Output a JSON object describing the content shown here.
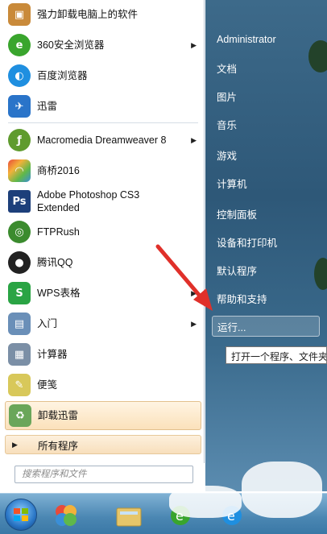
{
  "pinned_programs": [
    {
      "label": "强力卸载电脑上的软件",
      "icon": "uninstall-box-icon",
      "color": "#c98a3a",
      "has_submenu": false
    },
    {
      "label": "360安全浏览器",
      "icon": "360-browser-icon",
      "color": "#39a52d",
      "has_submenu": true
    },
    {
      "label": "百度浏览器",
      "icon": "baidu-browser-icon",
      "color": "#1f8fe0",
      "has_submenu": false
    },
    {
      "label": "迅雷",
      "icon": "xunlei-bird-icon",
      "color": "#2a74c9",
      "has_submenu": false
    }
  ],
  "recent_programs": [
    {
      "label": "Macromedia Dreamweaver 8",
      "icon": "dreamweaver-icon",
      "color": "#5f9b2e",
      "has_submenu": true
    },
    {
      "label": "商桥2016",
      "icon": "shangqiao-rainbow-icon",
      "color": "#e8a23a",
      "has_submenu": false
    },
    {
      "label": "Adobe Photoshop CS3",
      "label2": "Extended",
      "icon": "photoshop-icon",
      "color": "#1d3f7a",
      "has_submenu": false
    },
    {
      "label": "FTPRush",
      "icon": "ftprush-icon",
      "color": "#3b8b2e",
      "has_submenu": false
    },
    {
      "label": "腾讯QQ",
      "icon": "qq-penguin-icon",
      "color": "#222222",
      "has_submenu": false
    },
    {
      "label": "WPS表格",
      "icon": "wps-sheet-icon",
      "color": "#2aa444",
      "has_submenu": true
    },
    {
      "label": "入门",
      "icon": "getting-started-icon",
      "color": "#6a8fb8",
      "has_submenu": true
    },
    {
      "label": "计算器",
      "icon": "calculator-icon",
      "color": "#7b8fa6",
      "has_submenu": false
    },
    {
      "label": "便笺",
      "icon": "sticky-note-icon",
      "color": "#d8c85a",
      "has_submenu": false
    },
    {
      "label": "卸载迅雷",
      "icon": "recycle-uninstall-icon",
      "color": "#6aa65a",
      "has_submenu": false
    }
  ],
  "all_programs_label": "所有程序",
  "search_placeholder": "搜索程序和文件",
  "right_panel": {
    "items": [
      "Administrator",
      "文档",
      "图片",
      "音乐",
      "游戏",
      "计算机",
      "控制面板",
      "设备和打印机",
      "默认程序",
      "帮助和支持",
      "运行..."
    ]
  },
  "tooltip_text": "打开一个程序、文件夹",
  "taskbar": {
    "buttons": [
      "start-orb-icon",
      "360-taskbar-icon",
      "folder-taskbar-icon",
      "360-browser-taskbar-icon",
      "ie-taskbar-icon"
    ]
  },
  "colors": {
    "accent_arrow": "#e0302a",
    "right_panel": "#2e5878",
    "highlight": "#fbe1bb"
  }
}
